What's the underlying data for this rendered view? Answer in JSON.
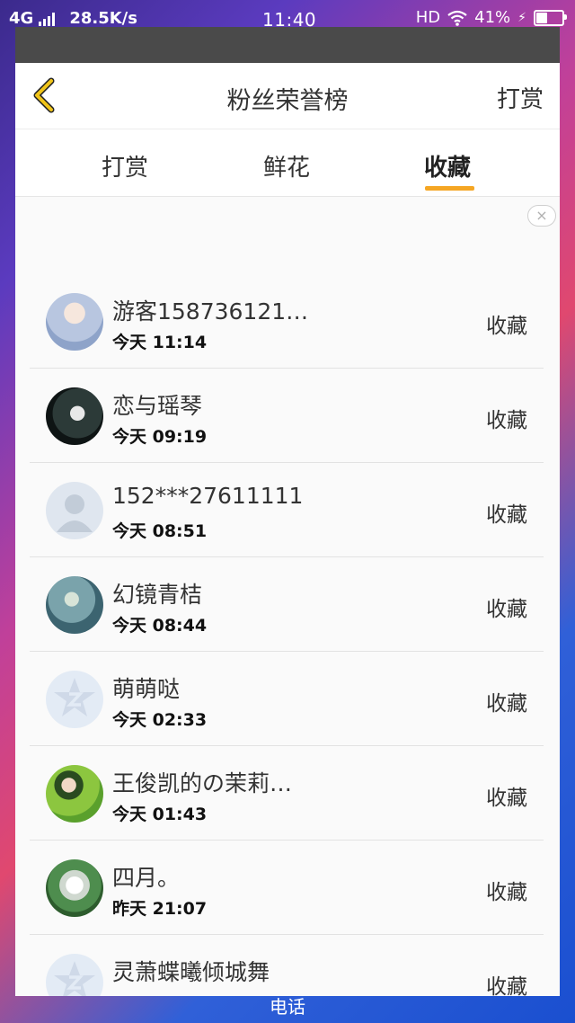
{
  "status_bar": {
    "network": "4G",
    "speed": "28.5K/s",
    "time": "11:40",
    "hd": "HD",
    "battery": "41%"
  },
  "header": {
    "title": "粉丝荣誉榜",
    "action": "打赏"
  },
  "tabs": [
    {
      "label": "打赏"
    },
    {
      "label": "鲜花"
    },
    {
      "label": "收藏"
    }
  ],
  "rows": [
    {
      "name": "游客158736121…",
      "time": "今天 11:14",
      "action": "收藏",
      "avatar_color": "#c9d3e8"
    },
    {
      "name": "恋与瑶琴",
      "time": "今天 09:19",
      "action": "收藏",
      "avatar_color": "#1e2a2a"
    },
    {
      "name": "152***27611111",
      "time": "今天 08:51",
      "action": "收藏",
      "avatar_color": "#dfe6ef"
    },
    {
      "name": "幻镜青桔",
      "time": "今天 08:44",
      "action": "收藏",
      "avatar_color": "#6d9aa8"
    },
    {
      "name": "萌萌哒",
      "time": "今天 02:33",
      "action": "收藏",
      "avatar_color": "#e3ebf5"
    },
    {
      "name": "王俊凯的の茉莉…",
      "time": "今天 01:43",
      "action": "收藏",
      "avatar_color": "#7cc242"
    },
    {
      "name": "四月。",
      "time": "昨天 21:07",
      "action": "收藏",
      "avatar_color": "#3e7b3e"
    },
    {
      "name": "灵萧蝶曦倾城舞",
      "time": "",
      "action": "收藏",
      "avatar_color": "#e3ebf5"
    }
  ],
  "bottom_text": "电话",
  "colors": {
    "accent": "#f5a623",
    "back_icon": "#e6b800"
  }
}
